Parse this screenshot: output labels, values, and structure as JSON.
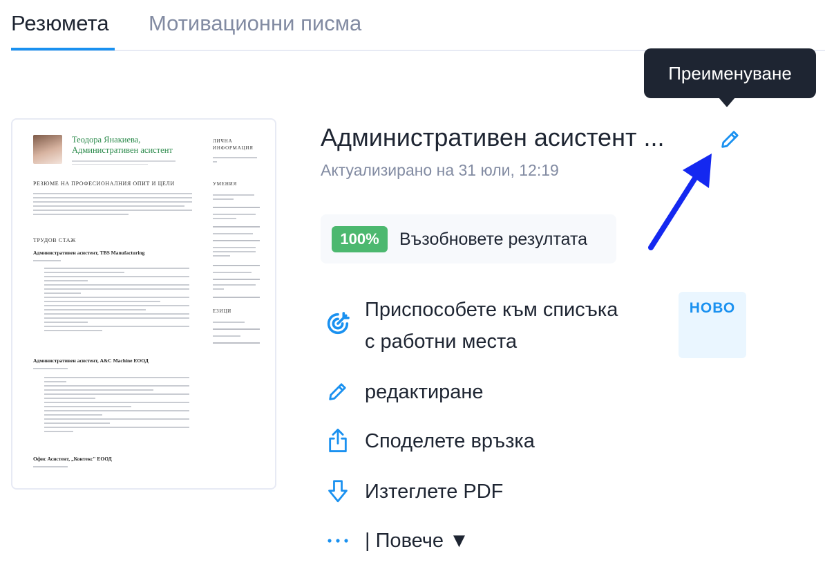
{
  "tabs": [
    {
      "label": "Резюмета",
      "active": true
    },
    {
      "label": "Мотивационни писма",
      "active": false
    }
  ],
  "tooltip": {
    "text": "Преименуване"
  },
  "document": {
    "title": "Административен асистент ...",
    "updated": "Актуализирано на 31 юли, 12:19"
  },
  "score": {
    "value": "100%",
    "label": "Възобновете резултата"
  },
  "actions": {
    "tailor": {
      "line1": "Приспособете към списъка",
      "line2": "с работни места",
      "badge": "НОВО"
    },
    "edit": {
      "label": "редактиране"
    },
    "share": {
      "label": "Споделете връзка"
    },
    "download": {
      "label": "Изтеглете PDF"
    },
    "more": {
      "label": "| Повече ▼"
    }
  },
  "resume_preview": {
    "name_line1": "Теодора Янакиева,",
    "name_line2": "Административен асистент",
    "sidebar_personal": "ЛИЧНА ИНФОРМАЦИЯ",
    "sidebar_skills": "УМЕНИЯ",
    "sidebar_languages": "ЕЗИЦИ",
    "profile_heading": "РЕЗЮМЕ НА ПРОФЕСИОНАЛНИЯ ОПИТ И ЦЕЛИ",
    "experience_heading": "ТРУДОВ СТАЖ",
    "job1": "Административен асистент, TBS Manufacturing",
    "job2": "Административен асистент, A&C Machine ЕООД",
    "job3": "Офис Асистент, „Контекс\" ЕООД"
  },
  "colors": {
    "accent": "#1a91f0",
    "tooltip_bg": "#1e2532",
    "score_green": "#4cb86f",
    "annotation_arrow": "#1428f0"
  },
  "icons": {
    "edit_title": "pencil-icon",
    "tailor": "target-icon",
    "edit": "pencil-icon",
    "share": "share-icon",
    "download": "download-icon",
    "more": "dots-icon"
  }
}
